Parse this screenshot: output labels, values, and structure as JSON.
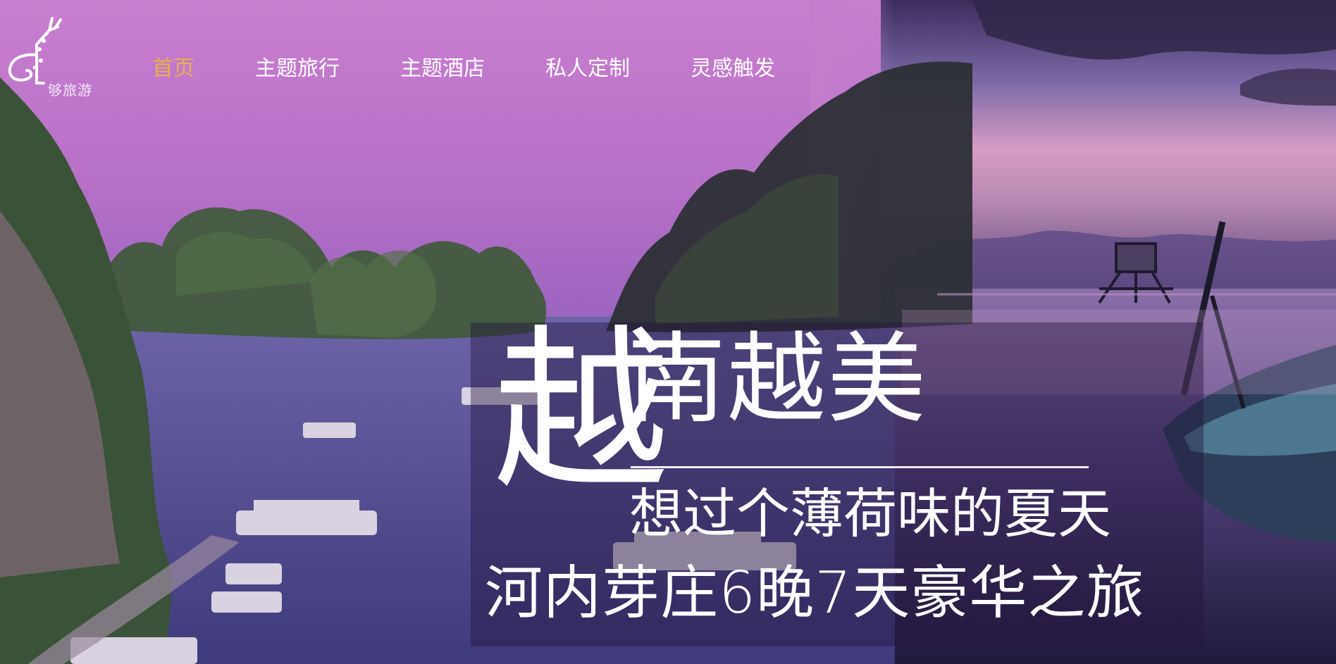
{
  "brand": {
    "logo_text": "够旅游"
  },
  "nav": {
    "items": [
      {
        "label": "首页",
        "active": true
      },
      {
        "label": "主题旅行",
        "active": false
      },
      {
        "label": "主题酒店",
        "active": false
      },
      {
        "label": "私人定制",
        "active": false
      },
      {
        "label": "灵感触发",
        "active": false
      }
    ]
  },
  "banner": {
    "big_char": "越",
    "title": "南越美",
    "subtitle": "想过个薄荷味的夏天",
    "tagline": "河内芽庄6晚7天豪华之旅"
  },
  "colors": {
    "active_nav": "#e8b04a",
    "sky_purple": "#c77ccf",
    "overlay": "#23143c"
  }
}
